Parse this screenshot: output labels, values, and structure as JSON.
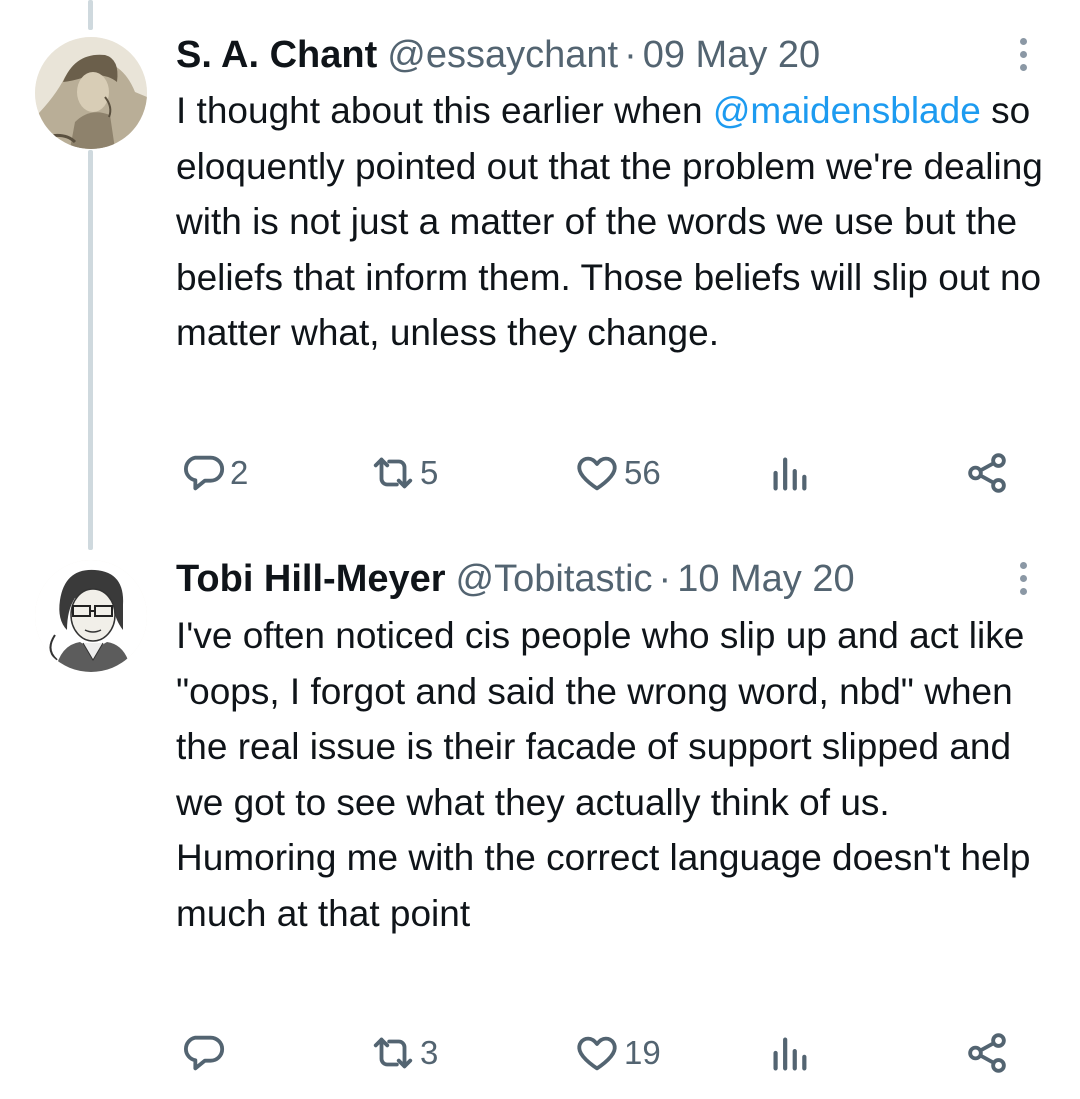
{
  "tweets": [
    {
      "author_name": "S. A. Chant",
      "handle": "@essaychant",
      "separator": "·",
      "date": "09 May 20",
      "text_before": "I thought about this earlier when ",
      "mention": "@maidensblade",
      "text_after": " so eloquently pointed out that the problem we're dealing with is not just a matter of the words we use but the beliefs that inform them. Those beliefs will slip out no matter what, unless they change.",
      "stats": {
        "replies": "2",
        "reposts": "5",
        "likes": "56"
      },
      "icons": [
        "reply-icon",
        "repost-icon",
        "like-icon",
        "views-icon",
        "share-icon",
        "more-icon"
      ]
    },
    {
      "author_name": "Tobi Hill-Meyer",
      "handle": "@Tobitastic",
      "separator": "·",
      "date": "10 May 20",
      "text": "I've often noticed cis people who slip up and act like \"oops, I forgot and said the wrong word, nbd\" when the real issue is their facade of support slipped and we got to see what they actually think of us. Humoring me with the correct language doesn't help much at that point",
      "stats": {
        "replies": "",
        "reposts": "3",
        "likes": "19"
      },
      "icons": [
        "reply-icon",
        "repost-icon",
        "like-icon",
        "views-icon",
        "share-icon",
        "more-icon"
      ]
    }
  ],
  "colors": {
    "text": "#0f1419",
    "secondary": "#536471",
    "link": "#1d9bf0",
    "thread_line": "#cfd9de"
  }
}
